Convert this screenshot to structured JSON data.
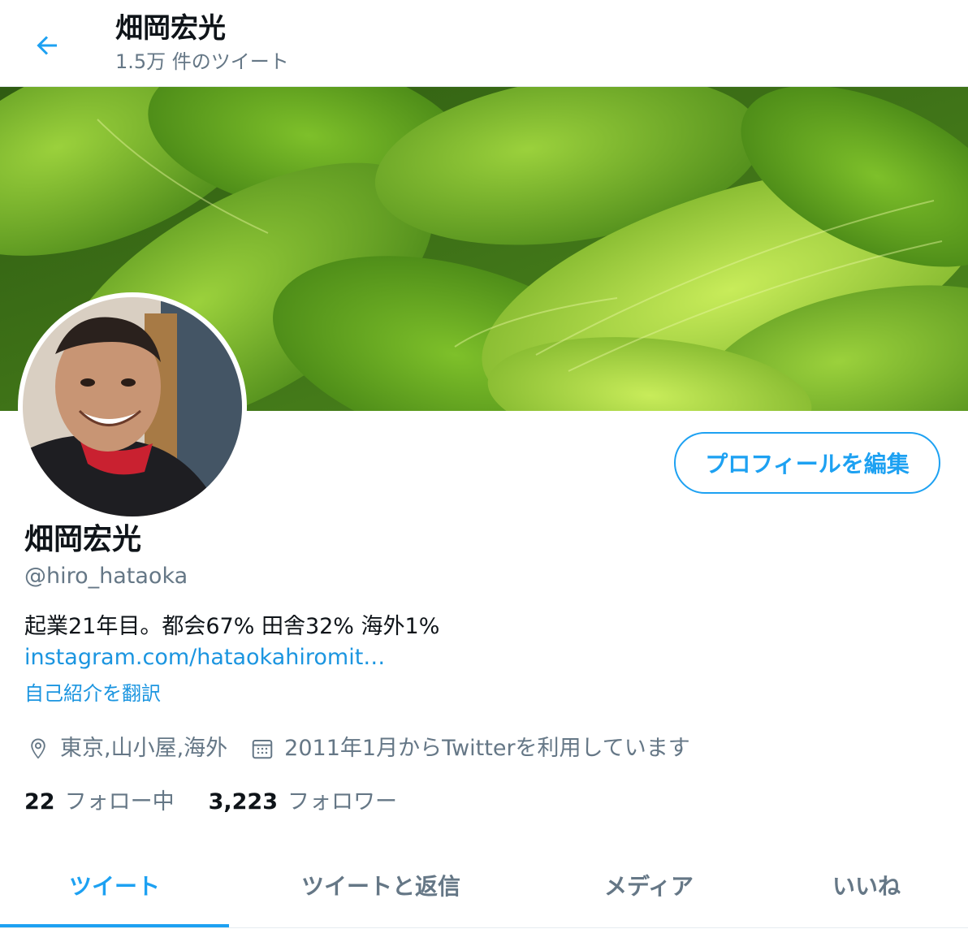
{
  "header": {
    "title": "畑岡宏光",
    "subtitle": "1.5万 件のツイート"
  },
  "profile": {
    "name": "畑岡宏光",
    "handle": "@hiro_hataoka",
    "bio": "起業21年目。都会67% 田舎32% 海外1%",
    "link": "instagram.com/hataokahiromit…",
    "translate": "自己紹介を翻訳",
    "location": "東京,山小屋,海外",
    "joined": "2011年1月からTwitterを利用しています",
    "following_count": "22",
    "following_label": "フォロー中",
    "followers_count": "3,223",
    "followers_label": "フォロワー",
    "edit_button": "プロフィールを編集"
  },
  "tabs": [
    {
      "label": "ツイート",
      "active": true
    },
    {
      "label": "ツイートと返信",
      "active": false
    },
    {
      "label": "メディア",
      "active": false
    },
    {
      "label": "いいね",
      "active": false
    }
  ],
  "colors": {
    "accent": "#1da1f2",
    "secondary_text": "#657786",
    "primary_text": "#0f1419"
  },
  "icons": [
    "back-arrow-icon",
    "location-pin-icon",
    "calendar-icon"
  ]
}
